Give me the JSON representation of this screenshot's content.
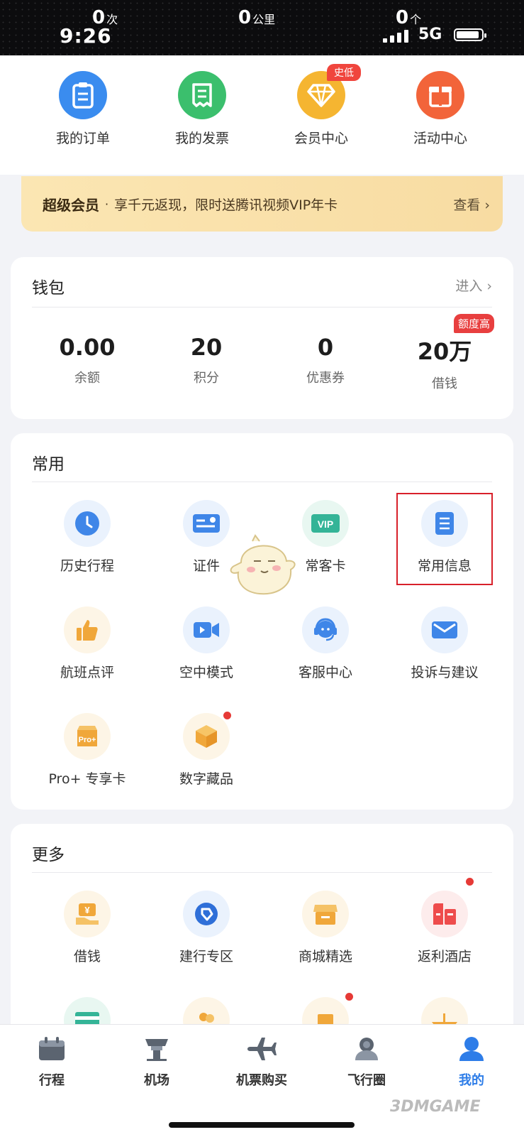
{
  "status_bar": {
    "time": "9:26",
    "trips": {
      "value": "0",
      "unit": "次"
    },
    "distance": {
      "value": "0",
      "unit": "公里"
    },
    "cities": {
      "value": "0",
      "unit": "个"
    },
    "network": "5G",
    "signal_bars": 4,
    "battery_level": 0.9
  },
  "quick_actions": [
    {
      "label": "我的订单",
      "icon": "order-clipboard-icon",
      "color": "#3a8cef"
    },
    {
      "label": "我的发票",
      "icon": "invoice-receipt-icon",
      "color": "#3bbf6d"
    },
    {
      "label": "会员中心",
      "icon": "diamond-icon",
      "color": "#f5b531",
      "tag": "史低"
    },
    {
      "label": "活动中心",
      "icon": "gift-icon",
      "color": "#f2643a"
    }
  ],
  "banner": {
    "title": "超级会员",
    "separator": "·",
    "text": "享千元返现，限时送腾讯视频VIP年卡",
    "action": "查看 ›"
  },
  "wallet": {
    "title": "钱包",
    "link": "进入 ›",
    "items": [
      {
        "value": "0.00",
        "label": "余额"
      },
      {
        "value": "20",
        "label": "积分"
      },
      {
        "value": "0",
        "label": "优惠券"
      },
      {
        "value": "20万",
        "label": "借钱",
        "tag": "额度高"
      }
    ]
  },
  "common": {
    "title": "常用",
    "items": [
      {
        "label": "历史行程",
        "icon": "clock-icon"
      },
      {
        "label": "证件",
        "icon": "id-card-icon"
      },
      {
        "label": "常客卡",
        "icon": "vip-card-icon",
        "badge_text": "VIP"
      },
      {
        "label": "常用信息",
        "icon": "document-icon",
        "highlighted": true
      },
      {
        "label": "航班点评",
        "icon": "thumbs-up-icon"
      },
      {
        "label": "空中模式",
        "icon": "video-camera-icon"
      },
      {
        "label": "客服中心",
        "icon": "headset-icon"
      },
      {
        "label": "投诉与建议",
        "icon": "mail-icon"
      },
      {
        "label": "Pro+ 专享卡",
        "icon": "pro-card-icon",
        "badge_text": "Pro+"
      },
      {
        "label": "数字藏品",
        "icon": "cube-icon",
        "red_dot": true
      }
    ]
  },
  "more": {
    "title": "更多",
    "items": [
      {
        "label": "借钱",
        "icon": "loan-yen-icon",
        "badge_text": "¥"
      },
      {
        "label": "建行专区",
        "icon": "ccb-bank-icon"
      },
      {
        "label": "商城精选",
        "icon": "shop-icon"
      },
      {
        "label": "返利酒店",
        "icon": "hotel-icon",
        "red_dot": true
      }
    ]
  },
  "tab_bar": [
    {
      "label": "行程",
      "icon": "calendar-icon"
    },
    {
      "label": "机场",
      "icon": "airport-tower-icon"
    },
    {
      "label": "机票购买",
      "icon": "airplane-icon"
    },
    {
      "label": "飞行圈",
      "icon": "community-icon"
    },
    {
      "label": "我的",
      "icon": "profile-icon",
      "active": true
    }
  ],
  "colors": {
    "primary_blue": "#2e7de8",
    "red_tag": "#e83f3f",
    "banner_gold": "#fbe6b3",
    "orange_icon": "#f0a73a"
  },
  "watermark": "3DMGAME"
}
